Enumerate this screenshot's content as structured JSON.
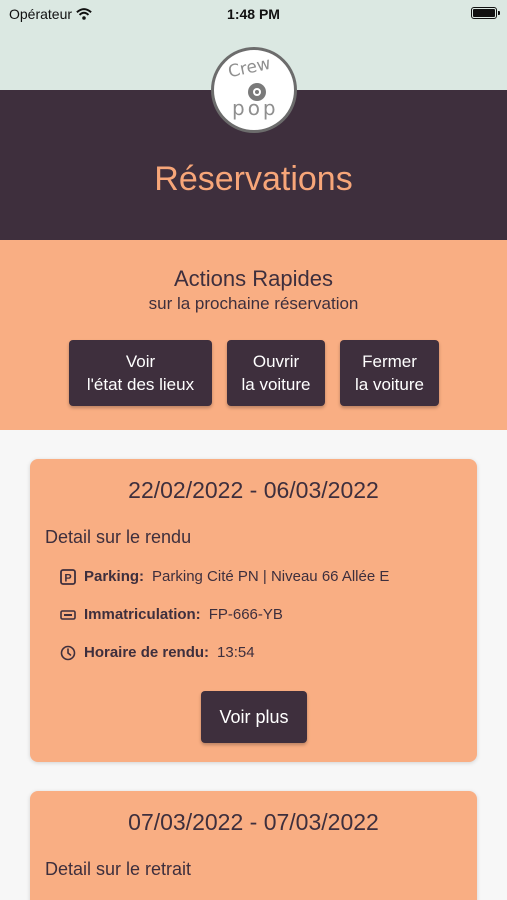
{
  "status_bar": {
    "carrier": "Opérateur",
    "time": "1:48 PM"
  },
  "logo": {
    "top_text": "Crew",
    "bottom_text": "pop"
  },
  "header": {
    "title": "Réservations"
  },
  "quick_actions": {
    "title": "Actions Rapides",
    "subtitle": "sur la prochaine réservation",
    "buttons": [
      {
        "line1": "Voir",
        "line2": "l'état des lieux"
      },
      {
        "line1": "Ouvrir",
        "line2": "la voiture"
      },
      {
        "line1": "Fermer",
        "line2": "la voiture"
      }
    ]
  },
  "reservations": [
    {
      "dates": "22/02/2022 - 06/03/2022",
      "detail_title": "Detail sur le rendu",
      "parking_label": "Parking:",
      "parking_value": "Parking Cité PN | Niveau 66 Allée E",
      "plate_label": "Immatriculation:",
      "plate_value": "FP-666-YB",
      "time_label": "Horaire de rendu:",
      "time_value": "13:54",
      "more_label": "Voir plus"
    },
    {
      "dates": "07/03/2022 - 07/03/2022",
      "detail_title": "Detail sur le retrait"
    }
  ],
  "colors": {
    "dark": "#3e2f3d",
    "accent": "#f9ae83",
    "title": "#f7a679",
    "status_bg": "#dbe8e2"
  },
  "icons": [
    "wifi-icon",
    "battery-icon",
    "wheel-icon",
    "parking-icon",
    "license-plate-icon",
    "clock-icon"
  ]
}
